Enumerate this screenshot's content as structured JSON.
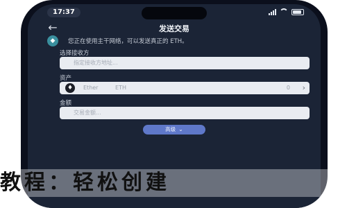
{
  "status_bar": {
    "time": "17:37"
  },
  "nav": {
    "back_icon": "back-arrow-icon",
    "title": "发送交易"
  },
  "notice": {
    "icon": "ethereum-icon",
    "text": "您正在使用主干网络，可以发送真正的 ETH。"
  },
  "form": {
    "recipient_label": "选择接收方",
    "recipient_placeholder": "指定接收方地址...",
    "asset_label": "资产",
    "asset": {
      "icon": "ether-coin-icon",
      "name": "Ether",
      "symbol": "ETH",
      "balance": "0",
      "chevron": "chevron-right-icon"
    },
    "amount_label": "金额",
    "amount_placeholder": "交易金额..."
  },
  "advanced_button": {
    "label": "高级",
    "chevron": "chevron-down-icon"
  },
  "overlay_text": "教程：轻松创建"
}
